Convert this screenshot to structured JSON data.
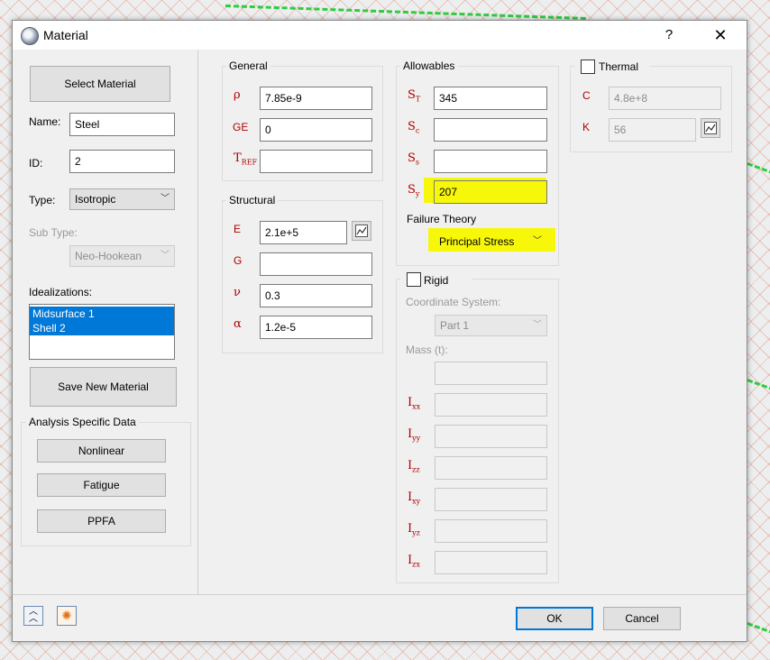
{
  "dialog": {
    "title": "Material",
    "help_label": "?",
    "close_label": "✕"
  },
  "left": {
    "select_material_label": "Select Material",
    "name_label": "Name:",
    "name_value": "Steel",
    "id_label": "ID:",
    "id_value": "2",
    "type_label": "Type:",
    "type_value": "Isotropic",
    "subtype_label": "Sub Type:",
    "subtype_value": "Neo-Hookean",
    "idealizations_label": "Idealizations:",
    "idealizations": [
      "Midsurface 1",
      "Shell 2"
    ],
    "save_new_label": "Save New Material",
    "analysis_group_title": "Analysis Specific Data",
    "nonlinear_label": "Nonlinear",
    "fatigue_label": "Fatigue",
    "ppfa_label": "PPFA"
  },
  "general": {
    "title": "General",
    "rho_symbol": "ρ",
    "rho_value": "7.85e-9",
    "ge_symbol": "GE",
    "ge_value": "0",
    "tref_symbol": "T",
    "tref_sub": "REF",
    "tref_value": ""
  },
  "structural": {
    "title": "Structural",
    "e_symbol": "E",
    "e_value": "2.1e+5",
    "g_symbol": "G",
    "g_value": "",
    "nu_symbol": "ν",
    "nu_value": "0.3",
    "alpha_symbol": "α",
    "alpha_value": "1.2e-5"
  },
  "allowables": {
    "title": "Allowables",
    "st_symbol": "S",
    "st_sub": "T",
    "st_value": "345",
    "sc_symbol": "S",
    "sc_sub": "c",
    "sc_value": "",
    "ss_symbol": "S",
    "ss_sub": "s",
    "ss_value": "",
    "sy_symbol": "S",
    "sy_sub": "y",
    "sy_value": "207",
    "failure_theory_label": "Failure Theory",
    "failure_theory_value": "Principal Stress"
  },
  "rigid": {
    "title": "Rigid",
    "coord_label": "Coordinate System:",
    "coord_value": "Part 1",
    "mass_label": "Mass (t):",
    "mass_value": "",
    "ixx_symbol": "I",
    "ixx_sub": "xx",
    "ixx_value": "",
    "iyy_symbol": "I",
    "iyy_sub": "yy",
    "iyy_value": "",
    "izz_symbol": "I",
    "izz_sub": "zz",
    "izz_value": "",
    "ixy_symbol": "I",
    "ixy_sub": "xy",
    "ixy_value": "",
    "iyz_symbol": "I",
    "iyz_sub": "yz",
    "iyz_value": "",
    "izx_symbol": "I",
    "izx_sub": "zx",
    "izx_value": ""
  },
  "thermal": {
    "title": "Thermal",
    "c_symbol": "C",
    "c_value": "4.8e+8",
    "k_symbol": "K",
    "k_value": "56"
  },
  "footer": {
    "ok_label": "OK",
    "cancel_label": "Cancel"
  },
  "colors": {
    "highlight": "#f7f70a",
    "symbol": "#b00000",
    "selection": "#0078d7"
  }
}
